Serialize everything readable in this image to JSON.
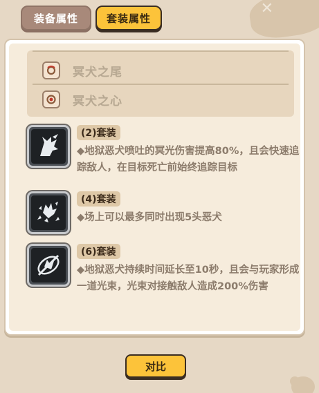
{
  "tabs": [
    {
      "label": "装备属性",
      "active": false
    },
    {
      "label": "套装属性",
      "active": true
    }
  ],
  "equipment": [
    {
      "name": "冥犬之尾",
      "icon": "tail-ring-icon"
    },
    {
      "name": "冥犬之心",
      "icon": "heart-ring-icon"
    }
  ],
  "sets": [
    {
      "tag": "(2)套装",
      "icon": "howling-wolf-icon",
      "desc": "◆地狱恶犬喷吐的冥光伤害提高80%，且会快速追踪敌人，在目标死亡前始终追踪目标"
    },
    {
      "tag": "(4)套装",
      "icon": "wolf-pack-icon",
      "desc": "◆场上可以最多同时出现5头恶犬"
    },
    {
      "tag": "(6)套装",
      "icon": "light-beam-wolf-icon",
      "desc": "◆地狱恶犬持续时间延长至10秒，且会与玩家形成一道光束，光束对接触敌人造成200%伤害"
    }
  ],
  "compare_button": "对比",
  "colors": {
    "accent": "#fcc33a",
    "tab_inactive": "#a8897a",
    "panel": "#f6ecdc",
    "muted_text": "#8c7c6c"
  }
}
